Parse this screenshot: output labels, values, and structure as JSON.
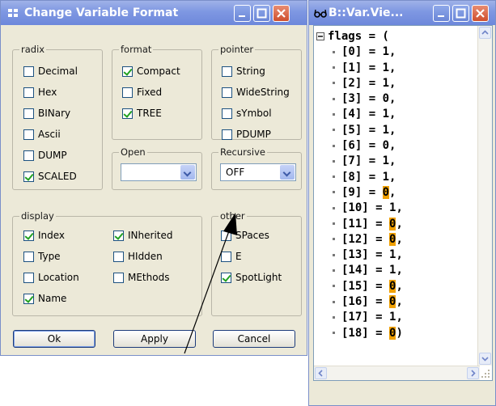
{
  "dialog": {
    "title": "Change Variable Format",
    "groups": {
      "radix": {
        "label": "radix",
        "items": [
          {
            "label": "Decimal",
            "checked": false
          },
          {
            "label": "Hex",
            "checked": false
          },
          {
            "label": "BINary",
            "checked": false
          },
          {
            "label": "Ascii",
            "checked": false
          },
          {
            "label": "DUMP",
            "checked": false
          },
          {
            "label": "SCALED",
            "checked": true
          }
        ]
      },
      "format": {
        "label": "format",
        "items": [
          {
            "label": "Compact",
            "checked": true
          },
          {
            "label": "Fixed",
            "checked": false
          },
          {
            "label": "TREE",
            "checked": true
          }
        ]
      },
      "open": {
        "label": "Open",
        "value": ""
      },
      "pointer": {
        "label": "pointer",
        "items": [
          {
            "label": "String",
            "checked": false
          },
          {
            "label": "WideString",
            "checked": false
          },
          {
            "label": "sYmbol",
            "checked": false
          },
          {
            "label": "PDUMP",
            "checked": false
          }
        ]
      },
      "recursive": {
        "label": "Recursive",
        "value": "OFF"
      },
      "display": {
        "label": "display",
        "items": [
          {
            "label": "Index",
            "checked": true
          },
          {
            "label": "Type",
            "checked": false
          },
          {
            "label": "Location",
            "checked": false
          },
          {
            "label": "Name",
            "checked": true
          },
          {
            "label": "INherited",
            "checked": true
          },
          {
            "label": "HIdden",
            "checked": false
          },
          {
            "label": "MEthods",
            "checked": false
          }
        ]
      },
      "other": {
        "label": "other",
        "items": [
          {
            "label": "SPaces",
            "checked": false
          },
          {
            "label": "E",
            "checked": false
          },
          {
            "label": "SpotLight",
            "checked": true
          }
        ]
      }
    },
    "buttons": {
      "ok": "Ok",
      "apply": "Apply",
      "cancel": "Cancel"
    }
  },
  "var_window": {
    "title": "B::Var.Vie...",
    "root": "flags = (",
    "elements": [
      {
        "index": "[0]",
        "value": "1",
        "changed": false,
        "sep": ","
      },
      {
        "index": "[1]",
        "value": "1",
        "changed": false,
        "sep": ","
      },
      {
        "index": "[2]",
        "value": "1",
        "changed": false,
        "sep": ","
      },
      {
        "index": "[3]",
        "value": "0",
        "changed": false,
        "sep": ","
      },
      {
        "index": "[4]",
        "value": "1",
        "changed": false,
        "sep": ","
      },
      {
        "index": "[5]",
        "value": "1",
        "changed": false,
        "sep": ","
      },
      {
        "index": "[6]",
        "value": "0",
        "changed": false,
        "sep": ","
      },
      {
        "index": "[7]",
        "value": "1",
        "changed": false,
        "sep": ","
      },
      {
        "index": "[8]",
        "value": "1",
        "changed": false,
        "sep": ","
      },
      {
        "index": "[9]",
        "value": "0",
        "changed": true,
        "sep": ","
      },
      {
        "index": "[10]",
        "value": "1",
        "changed": false,
        "sep": ","
      },
      {
        "index": "[11]",
        "value": "0",
        "changed": true,
        "sep": ","
      },
      {
        "index": "[12]",
        "value": "0",
        "changed": true,
        "sep": ","
      },
      {
        "index": "[13]",
        "value": "1",
        "changed": false,
        "sep": ","
      },
      {
        "index": "[14]",
        "value": "1",
        "changed": false,
        "sep": ","
      },
      {
        "index": "[15]",
        "value": "0",
        "changed": true,
        "sep": ","
      },
      {
        "index": "[16]",
        "value": "0",
        "changed": true,
        "sep": ","
      },
      {
        "index": "[17]",
        "value": "1",
        "changed": false,
        "sep": ","
      },
      {
        "index": "[18]",
        "value": "0",
        "changed": true,
        "sep": ")"
      }
    ]
  },
  "colors": {
    "changed_highlight": "#f0a000",
    "titlebar": "#7e97e2",
    "checkmark": "#21a121"
  }
}
